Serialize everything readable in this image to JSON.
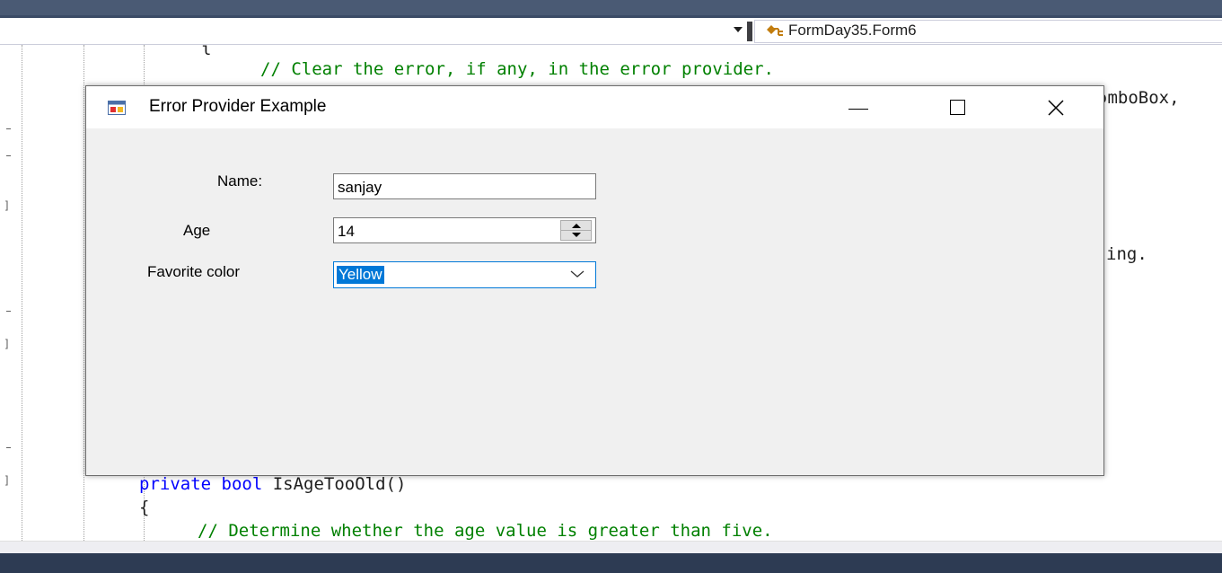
{
  "ide": {
    "nav_class": "FormDay35.Form6",
    "code_lines": {
      "clear_comment": "// Clear the error, if any, in the error provider.",
      "combobox_fragment": "ɔmboBox,",
      "string_fragment": "ing.",
      "method_signature_kw": "private bool ",
      "method_signature_name": "IsAgeTooOld()",
      "open_brace": "{",
      "age_comment": "// Determine whether the age value is greater than five."
    }
  },
  "form": {
    "title": "Error Provider Example",
    "name_label": "Name:",
    "name_value": "sanjay",
    "age_label": "Age",
    "age_value": "14",
    "color_label": "Favorite color",
    "color_value": "Yellow"
  }
}
